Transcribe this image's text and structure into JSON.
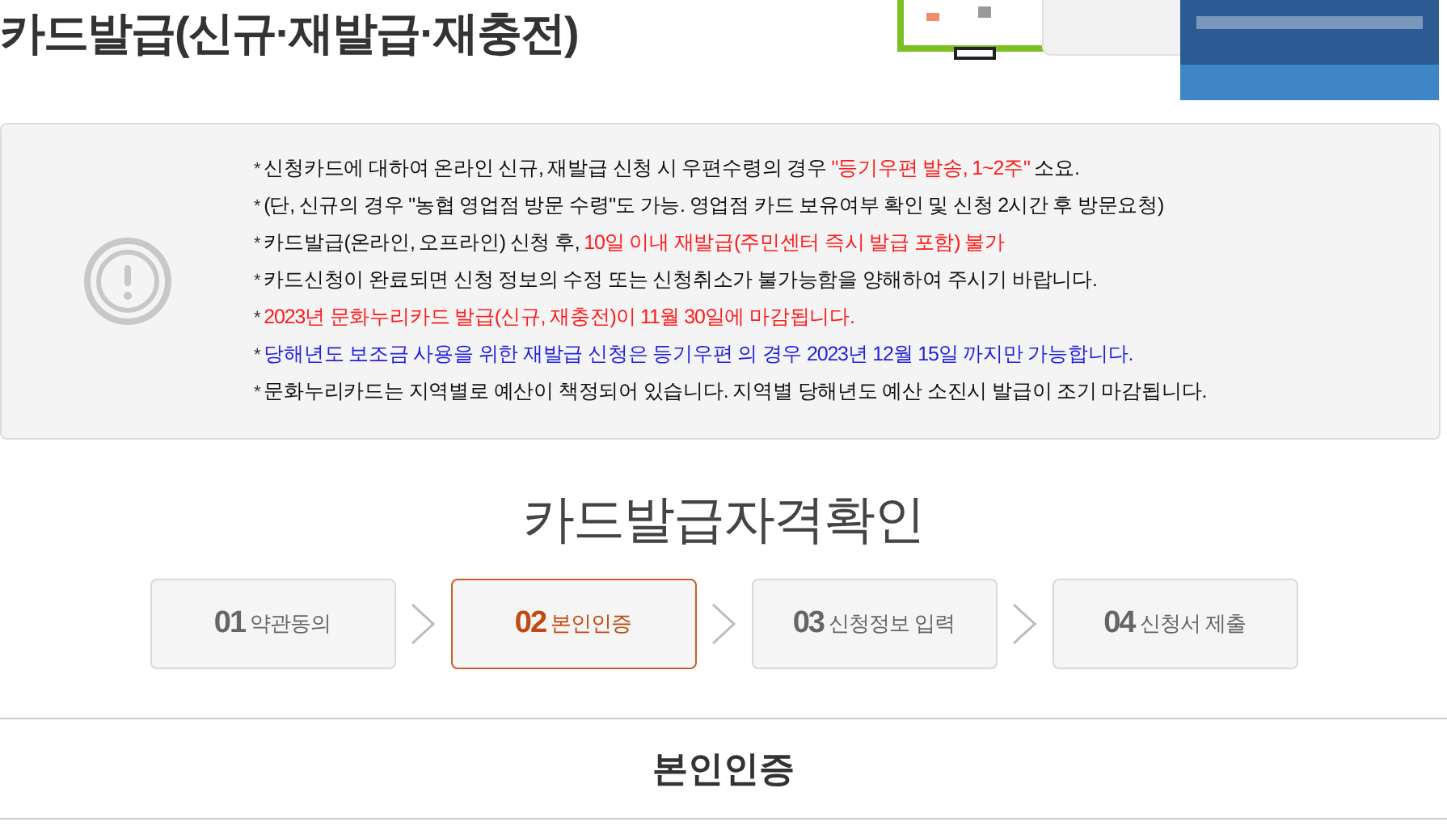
{
  "page_title": "카드발급(신규·재발급·재충전)",
  "notice": {
    "lines": [
      {
        "segments": [
          {
            "text": "* ",
            "kind": "bullet"
          },
          {
            "text": "신청카드에 대하여 온라인 신규, 재발급 신청 시 우편수령의 경우 ",
            "kind": "plain"
          },
          {
            "text": "\"등기우편 발송, 1~2주\"",
            "kind": "warning"
          },
          {
            "text": " 소요.",
            "kind": "plain"
          }
        ]
      },
      {
        "segments": [
          {
            "text": "* ",
            "kind": "bullet"
          },
          {
            "text": "(단, 신규의 경우 \"농협 영업점 방문 수령\"도 가능. 영업점 카드 보유여부 확인 및 신청 2시간 후 방문요청)",
            "kind": "plain"
          }
        ]
      },
      {
        "segments": [
          {
            "text": "* ",
            "kind": "bullet"
          },
          {
            "text": "카드발급(온라인, 오프라인) 신청 후, ",
            "kind": "plain"
          },
          {
            "text": "10일 이내 재발급(주민센터 즉시 발급 포함) 불가",
            "kind": "warning"
          }
        ]
      },
      {
        "segments": [
          {
            "text": "* ",
            "kind": "bullet"
          },
          {
            "text": "카드신청이 완료되면 신청 정보의 수정 또는 신청취소가 불가능함을 양해하여 주시기 바랍니다.",
            "kind": "plain"
          }
        ]
      },
      {
        "segments": [
          {
            "text": "* ",
            "kind": "bullet"
          },
          {
            "text": "2023년 문화누리카드 발급(신규, 재충전)이 11월 30일에 마감됩니다.",
            "kind": "warning"
          }
        ]
      },
      {
        "segments": [
          {
            "text": "* ",
            "kind": "bullet"
          },
          {
            "text": "당해년도 보조금 사용을 위한 재발급 신청은 등기우편 의 경우 2023년 12월 15일 까지만 가능합니다.",
            "kind": "info"
          }
        ]
      },
      {
        "segments": [
          {
            "text": "* ",
            "kind": "bullet"
          },
          {
            "text": "문화누리카드는 지역별로 예산이 책정되어 있습니다. 지역별 당해년도 예산 소진시 발급이 조기 마감됩니다.",
            "kind": "plain"
          }
        ]
      }
    ]
  },
  "section_title": "카드발급자격확인",
  "steps": [
    {
      "number": "01",
      "label": "약관동의",
      "selected": false
    },
    {
      "number": "02",
      "label": "본인인증",
      "selected": true
    },
    {
      "number": "03",
      "label": "신청정보 입력",
      "selected": false
    },
    {
      "number": "04",
      "label": "신청서 제출",
      "selected": false
    }
  ],
  "subsection_title": "본인인증"
}
